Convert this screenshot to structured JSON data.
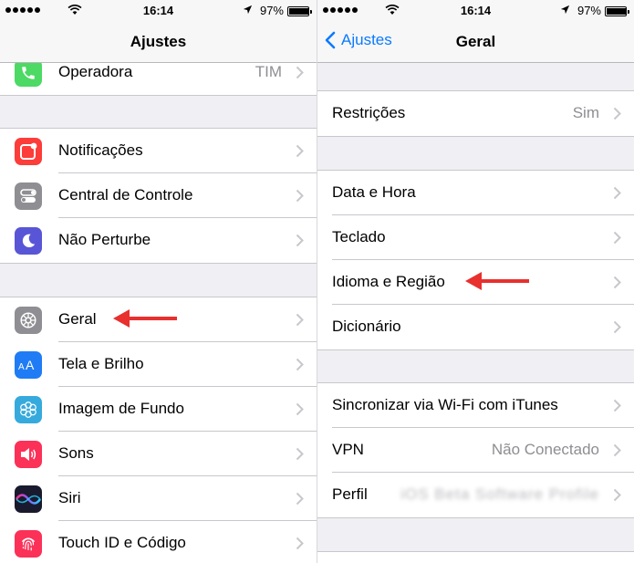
{
  "status": {
    "time": "16:14",
    "battery": "97%",
    "battery_level": 0.97
  },
  "left": {
    "title": "Ajustes",
    "carrier_row": {
      "label": "Operadora",
      "detail": "TIM",
      "icon": "phone-icon",
      "color": "#4cd964"
    },
    "group1": [
      {
        "label": "Notificações",
        "icon": "notifications-icon",
        "color": "#fc3d39"
      },
      {
        "label": "Central de Controle",
        "icon": "control-center-icon",
        "color": "#8e8e93"
      },
      {
        "label": "Não Perturbe",
        "icon": "moon-icon",
        "color": "#5856d6"
      }
    ],
    "group2": [
      {
        "label": "Geral",
        "icon": "gear-icon",
        "color": "#8e8e93"
      },
      {
        "label": "Tela e Brilho",
        "icon": "display-aa-icon",
        "color": "#1f7cf5"
      },
      {
        "label": "Imagem de Fundo",
        "icon": "wallpaper-flower-icon",
        "color": "#36aadc"
      },
      {
        "label": "Sons",
        "icon": "speaker-icon",
        "color": "#fc3158"
      },
      {
        "label": "Siri",
        "icon": "siri-icon",
        "color": "#1a1a2e"
      },
      {
        "label": "Touch ID e Código",
        "icon": "fingerprint-icon",
        "color": "#fc3158"
      }
    ]
  },
  "right": {
    "back_label": "Ajustes",
    "title": "Geral",
    "group1": [
      {
        "label": "Restrições",
        "detail": "Sim"
      }
    ],
    "group2": [
      {
        "label": "Data e Hora"
      },
      {
        "label": "Teclado"
      },
      {
        "label": "Idioma e Região"
      },
      {
        "label": "Dicionário"
      }
    ],
    "group3": [
      {
        "label": "Sincronizar via Wi-Fi com iTunes"
      },
      {
        "label": "VPN",
        "detail": "Não Conectado"
      },
      {
        "label": "Perfil",
        "detail": "iOS Beta Software Profile"
      }
    ]
  },
  "annotations": {
    "arrow_color": "#e8302e"
  }
}
